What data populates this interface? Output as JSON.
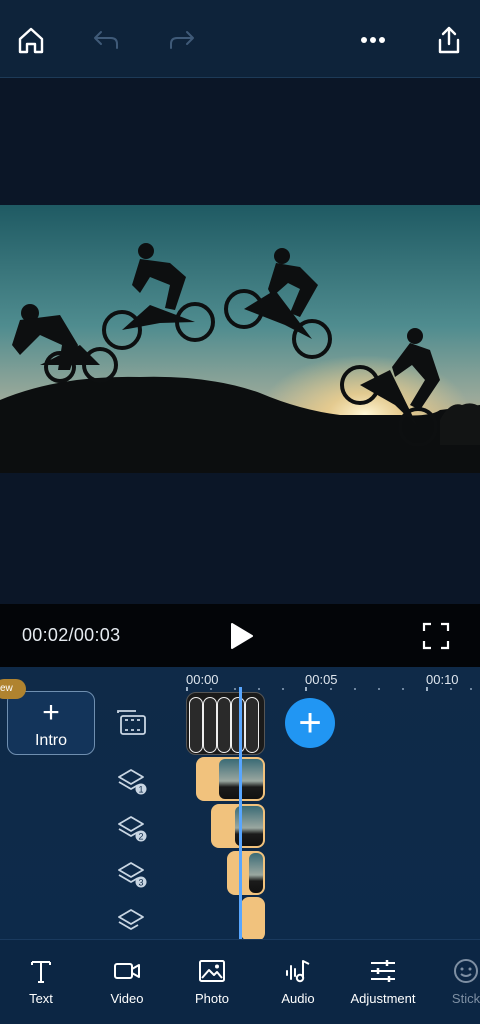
{
  "topbar": {
    "home": "home-icon",
    "undo": "undo-icon",
    "redo": "redo-icon",
    "more": "more-icon",
    "share": "share-icon"
  },
  "playback": {
    "current_time": "00:02/00:03"
  },
  "timeline": {
    "ruler": [
      "00:00",
      "00:05",
      "00:10"
    ],
    "new_badge": "ew",
    "intro_plus": "+",
    "intro_label": "Intro",
    "overlay_badges": [
      "1",
      "2",
      "3"
    ],
    "add_symbol": "+"
  },
  "toolbar": {
    "items": [
      {
        "label": "Text",
        "icon": "text-icon"
      },
      {
        "label": "Video",
        "icon": "video-icon"
      },
      {
        "label": "Photo",
        "icon": "photo-icon"
      },
      {
        "label": "Audio",
        "icon": "audio-icon"
      },
      {
        "label": "Adjustment",
        "icon": "adjustment-icon"
      },
      {
        "label": "Stick",
        "icon": "sticker-icon"
      }
    ]
  },
  "colors": {
    "accent": "#2196f3",
    "playhead": "#58a6ff",
    "overlay_clip": "#f1c27d",
    "background": "#0b1a2c"
  }
}
